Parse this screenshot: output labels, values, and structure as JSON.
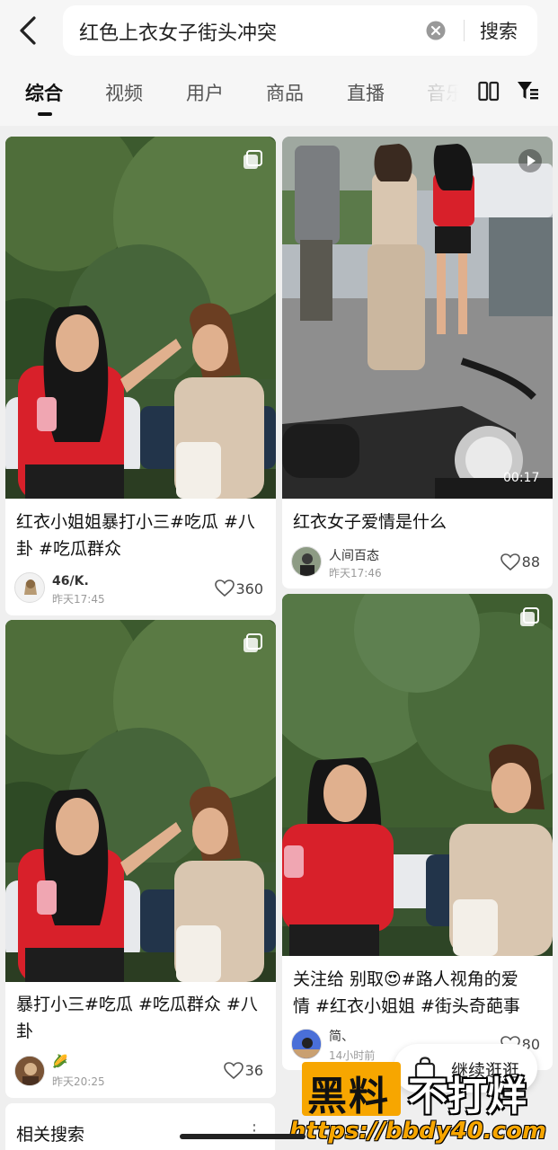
{
  "header": {
    "search_query": "红色上衣女子街头冲突",
    "search_button": "搜索"
  },
  "tabs": [
    {
      "label": "综合",
      "active": true
    },
    {
      "label": "视频"
    },
    {
      "label": "用户"
    },
    {
      "label": "商品"
    },
    {
      "label": "直播"
    },
    {
      "label": "音乐"
    }
  ],
  "cards": [
    {
      "title_line1": "红衣小姐姐暴打小三#吃瓜 #八",
      "title_line2": "卦 #吃瓜群众",
      "author": "46/K.",
      "time": "昨天17:45",
      "likes": "360",
      "media": "image-set"
    },
    {
      "title_line1": "红衣女子爱情是什么",
      "author": "人间百态",
      "time": "昨天17:46",
      "likes": "88",
      "media": "video",
      "duration": "00:17"
    },
    {
      "title_line1": "暴打小三#吃瓜 #吃瓜群众 #八",
      "title_line2": "卦",
      "author": "🌽",
      "time": "昨天20:25",
      "likes": "36",
      "media": "image-set"
    },
    {
      "title_line1": "关注给 别取😍#路人视角的爱",
      "title_line2": "情 #红衣小姐姐 #街头奇葩事",
      "author": "简、",
      "time": "14小时前",
      "likes": "80",
      "media": "image-set"
    }
  ],
  "related": {
    "label": "相关搜索"
  },
  "continue_button": {
    "label": "继续逛逛"
  },
  "watermark": {
    "main": "黑料",
    "sub": "不打烊",
    "url": "https://bbdy40.com"
  },
  "colors": {
    "accent": "#f7a600",
    "shirt_red": "#d8202a",
    "beige": "#d9c6b0"
  }
}
